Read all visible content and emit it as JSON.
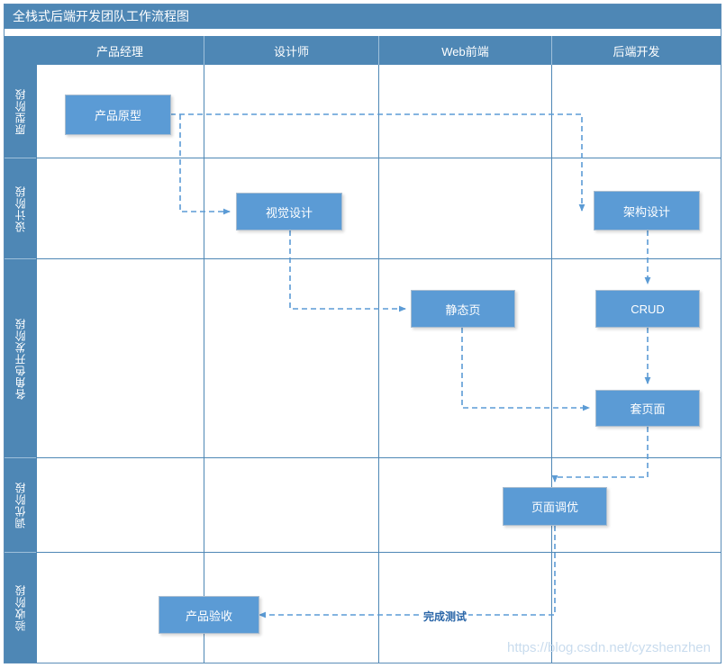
{
  "diagram": {
    "title": "全栈式后端开发团队工作流程图",
    "columns": [
      {
        "label": "产品经理"
      },
      {
        "label": "设计师"
      },
      {
        "label": "Web前端"
      },
      {
        "label": "后端开发"
      }
    ],
    "rows": [
      {
        "label": "原型阶段"
      },
      {
        "label": "设计阶段"
      },
      {
        "label": "各角色开发阶段"
      },
      {
        "label": "调优阶段"
      },
      {
        "label": "验收阶段"
      }
    ],
    "nodes": [
      {
        "id": "prototype",
        "label": "产品原型",
        "lane": "产品经理",
        "phase": "原型阶段"
      },
      {
        "id": "visual",
        "label": "视觉设计",
        "lane": "设计师",
        "phase": "设计阶段"
      },
      {
        "id": "arch",
        "label": "架构设计",
        "lane": "后端开发",
        "phase": "设计阶段"
      },
      {
        "id": "static",
        "label": "静态页",
        "lane": "Web前端",
        "phase": "各角色开发阶段"
      },
      {
        "id": "crud",
        "label": "CRUD",
        "lane": "后端开发",
        "phase": "各角色开发阶段"
      },
      {
        "id": "assemble",
        "label": "套页面",
        "lane": "后端开发",
        "phase": "各角色开发阶段"
      },
      {
        "id": "tuning",
        "label": "页面调优",
        "lane": "后端开发",
        "phase": "调优阶段"
      },
      {
        "id": "acceptance",
        "label": "产品验收",
        "lane": "产品经理",
        "phase": "验收阶段"
      }
    ],
    "edges": [
      {
        "from": "prototype",
        "to": "arch",
        "label": ""
      },
      {
        "from": "prototype",
        "to": "visual",
        "label": ""
      },
      {
        "from": "visual",
        "to": "static",
        "label": ""
      },
      {
        "from": "arch",
        "to": "crud",
        "label": ""
      },
      {
        "from": "crud",
        "to": "assemble",
        "label": ""
      },
      {
        "from": "static",
        "to": "assemble",
        "label": ""
      },
      {
        "from": "assemble",
        "to": "tuning",
        "label": ""
      },
      {
        "from": "tuning",
        "to": "acceptance",
        "label": "完成测试"
      }
    ],
    "edge_labels": {
      "complete_test": "完成测试"
    },
    "watermark": "https://blog.csdn.net/cyzshenzhen",
    "colors": {
      "header": "#4e87b5",
      "node_fill": "#5b9bd5",
      "connector": "#5b9bd5",
      "grid": "#4e87b5",
      "text_on_fill": "#ffffff",
      "edge_label": "#2a66a8",
      "watermark": "#c9dcee"
    }
  }
}
